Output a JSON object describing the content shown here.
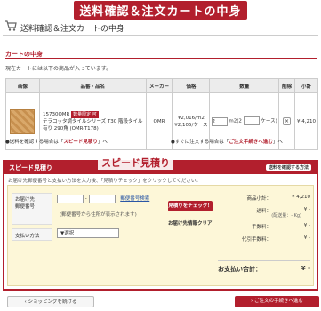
{
  "banner": "送料確認＆注文カートの中身",
  "header": {
    "title": "送料確認＆注文カートの中身"
  },
  "cart": {
    "section_label": "カートの中身",
    "lead_text": "現在カートには以下の商品が入っています。",
    "columns": [
      "画像",
      "品番・品名",
      "メーカー",
      "価格",
      "数量",
      "削除",
      "小計"
    ],
    "item": {
      "code": "15730OMR",
      "tag": "数量限定 可",
      "name": "テラコッタ調タイルシリーズ T30 階段タイル",
      "name2": "有り 290角 (OMR-T178)",
      "maker": "OMR",
      "price1": "¥2,016/m2",
      "price2": "¥2,105/ケース",
      "qty1": "2",
      "unit1": "m2(2",
      "unit2": "ケース)",
      "delete_icon": "×",
      "subtotal": "¥ 4,210"
    },
    "note_left_prefix": "●送料を確認する場合は「",
    "note_left_link": "スピード見積り",
    "note_left_suffix": "」へ",
    "note_right_prefix": "●すぐに注文する場合は「",
    "note_right_link": "ご注文手続きへ進む",
    "note_right_suffix": "」へ"
  },
  "quote": {
    "heading": "スピード見積り",
    "overlay_label": "スピード見積り",
    "help_link": "送料を確認する方法",
    "note": "お届け先郵便番号と支払い方法を入力後、「見積りチェック」をクリックしてください。",
    "zip_label1": "お届け先",
    "zip_label2": "郵便番号",
    "zip_dash": "-",
    "zip_lookup": "郵便番号検索",
    "zip_note": "(郵便番号から住所が表示されます)",
    "pay_label": "支払い方法",
    "pay_select": "▼選択",
    "check_button": "見積りをチェック！",
    "clear_link": "お届け先情報クリア",
    "rows": [
      {
        "label": "商品小計：",
        "value": "¥ 4,210"
      },
      {
        "label": "送料：",
        "value": "¥ -",
        "sub": "(配送量：- Kg)"
      },
      {
        "label": "手数料：",
        "value": "¥ -"
      },
      {
        "label": "代引手数料：",
        "value": "¥ -"
      }
    ],
    "total_label": "お支払い合計：",
    "total_value": "¥ -"
  },
  "buttons": {
    "back": "‹ ショッピングを続ける",
    "next": "› ご注文の手続きへ進む"
  },
  "colors": {
    "accent": "#b21f2d",
    "quote_bg": "#fdf7d8"
  }
}
